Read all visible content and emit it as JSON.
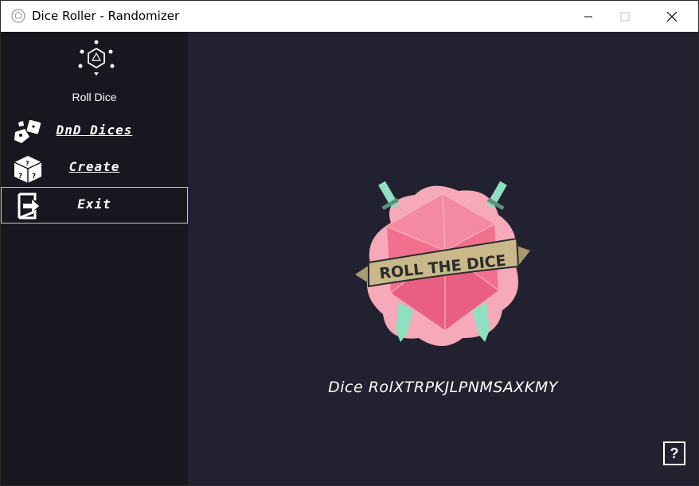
{
  "window": {
    "title": "Dice Roller - Randomizer",
    "controls": [
      "minimize",
      "maximize",
      "close"
    ]
  },
  "sidebar": {
    "logo_label": "Roll Dice",
    "items": [
      {
        "label": "DnD Dices",
        "icon": "dice-pair-icon"
      },
      {
        "label": "Create",
        "icon": "mystery-dice-icon"
      },
      {
        "label": "Exit",
        "icon": "exit-icon"
      }
    ]
  },
  "main": {
    "emblem_text": "ROLL THE DICE",
    "result_text": "Dice RolXTRPKJLPNMSAXKMY",
    "help_label": "?"
  },
  "colors": {
    "sidebar_bg": "#18171f",
    "main_bg": "#222130",
    "dice_pink": "#f06a8a",
    "banner": "#c9b98a",
    "sword": "#8fe0c0"
  }
}
